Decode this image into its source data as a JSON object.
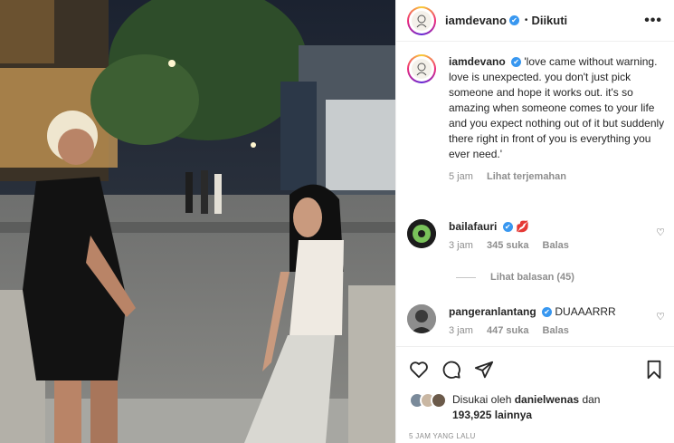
{
  "header": {
    "username": "iamdevano",
    "verified": "✔",
    "separator": "•",
    "follow_status": "Diikuti",
    "more": "•••"
  },
  "caption": {
    "username": "iamdevano",
    "text": "'love came without warning. love is unexpected. you don't just pick someone and hope it works out. it's so amazing when someone comes to your life and you expect nothing out of it but suddenly there right in front of you is everything you ever need.'",
    "time": "5 jam",
    "translate": "Lihat terjemahan"
  },
  "comments": [
    {
      "username": "bailafauri",
      "text": "💋",
      "time": "3 jam",
      "likes": "345 suka",
      "reply": "Balas"
    },
    {
      "username": "pangeranlantang",
      "text": "DUAAARRR",
      "time": "3 jam",
      "likes": "447 suka",
      "reply": "Balas"
    }
  ],
  "view_replies": "Lihat balasan (45)",
  "likes": {
    "prefix": "Disukai oleh",
    "user": "danielwenas",
    "conj": "dan",
    "count": "193,925",
    "suffix": "lainnya"
  },
  "posted": "5 JAM YANG LALU",
  "icons": {
    "heart": "heart-icon",
    "comment": "comment-icon",
    "share": "share-icon",
    "bookmark": "bookmark-icon"
  },
  "colors": {
    "verified": "#3897f0",
    "muted": "#8e8e8e",
    "text": "#262626"
  }
}
